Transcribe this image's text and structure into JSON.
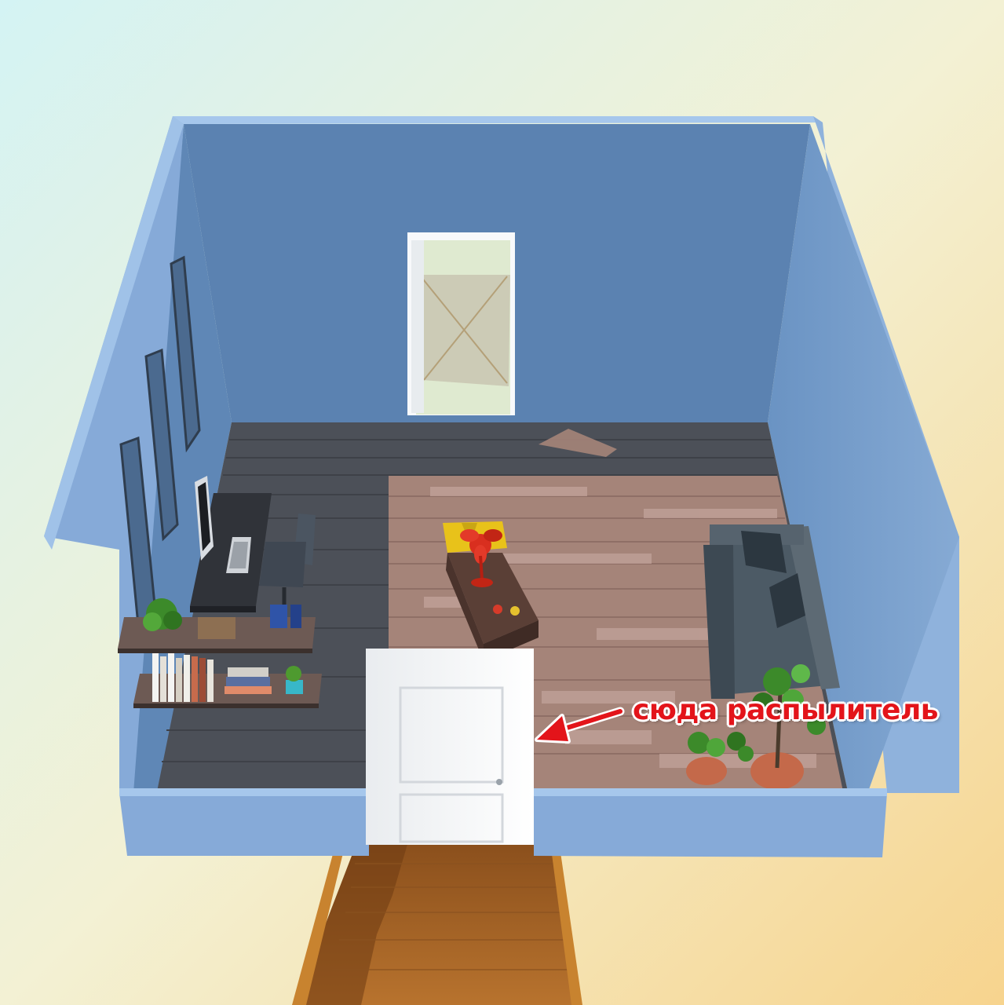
{
  "scene": {
    "kind": "isometric-room-cutaway",
    "palette": {
      "background_top_left": "#d4f3f4",
      "background_bottom_right": "#f7d48e",
      "wall_outer": "#86aad8",
      "wall_inner": "#5d85b3",
      "wall_top": "#9cc0ea",
      "floor_dark": "#4a4e56",
      "floor_light": "#a9877f",
      "door_white": "#f2f3f4",
      "stairs": "#a8682c",
      "annotation": "#e3141a",
      "fan": "#d92f1f",
      "pillow_yellow": "#e8c21a",
      "sofa": "#4c5a65",
      "plant_green": "#3c8a2a",
      "pot_terracotta": "#c4694a"
    },
    "objects": [
      "back-doorway",
      "window-panels",
      "desk",
      "monitor",
      "keyboard",
      "office-chair",
      "wall-shelf-upper",
      "wall-shelf-lower",
      "books",
      "potted-plant-small",
      "coffee-table",
      "red-fan",
      "yellow-pillow",
      "sofa",
      "sofa-cushions",
      "potted-tree",
      "potted-plant-floor",
      "front-door",
      "staircase",
      "handrails"
    ]
  },
  "annotation": {
    "label": "сюда распылитель",
    "pointer": "arrow-left-icon"
  }
}
